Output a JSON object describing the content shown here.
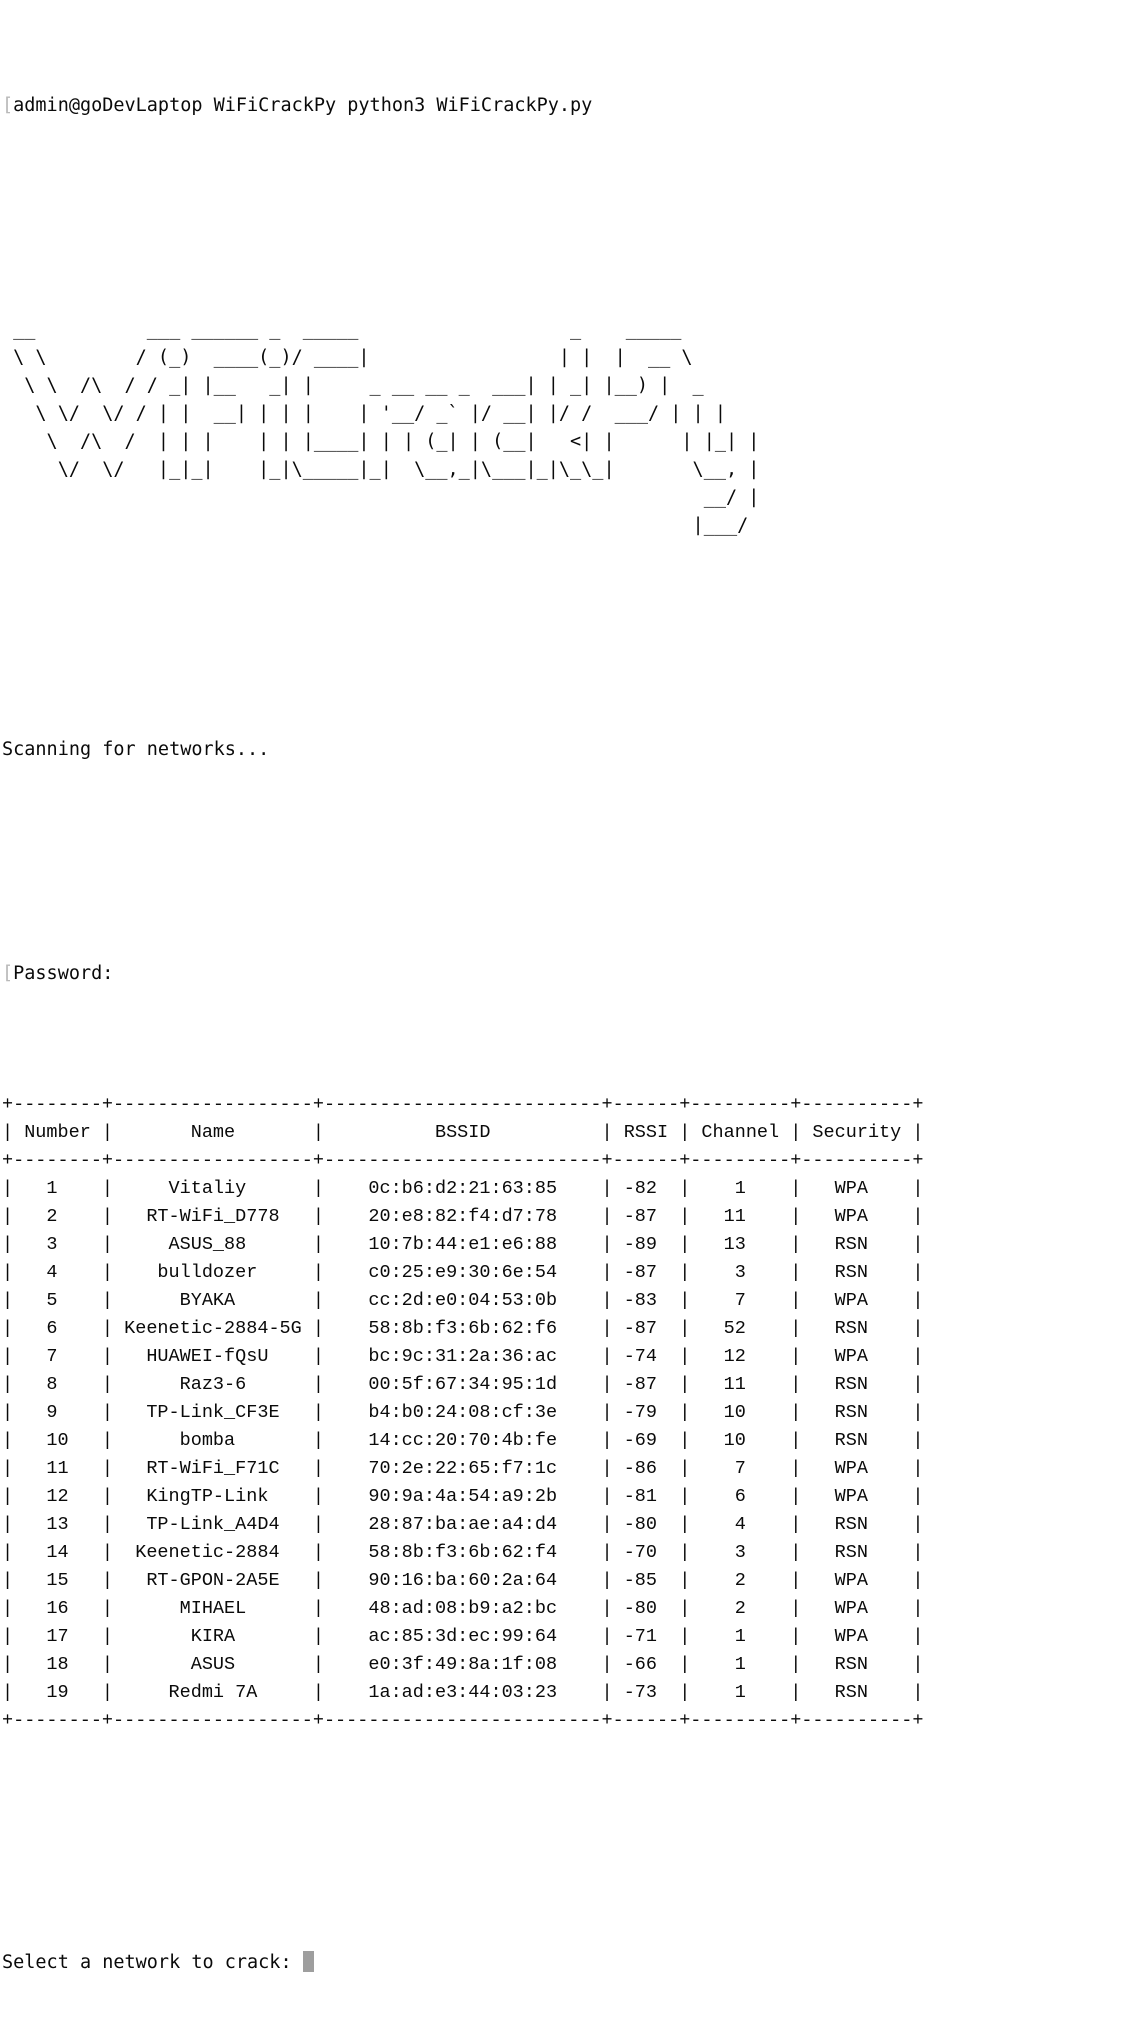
{
  "terminal": {
    "prompt_line": "[admin@goDevLaptop WiFiCrackPy python3 WiFiCrackPy.py",
    "banner": [
      " __          ___ ______ _  _____                   _    _____              ",
      " \\ \\        / (_)  ____(_)/ ____|                 | |  |  __ \\             ",
      "  \\ \\  /\\  / / _| |__   _| |     _ __ __ _  ___| | _| |__) |  _          ",
      "   \\ \\/  \\/ / | |  __| | | |    | '__/ _` |/ __| |/ /  ___/ | | |         ",
      "    \\  /\\  /  | | |    | | |____| | | (_| | (__|   <| |      | |_| |        ",
      "     \\/  \\/   |_|_|    |_|\\_____|_|  \\__,_|\\___|_|\\_\\_|       \\__, |       ",
      "                                                               __/ |       ",
      "                                                              |___/        "
    ],
    "scanning_message": "Scanning for networks...",
    "password_prompt": "Password:",
    "select_prompt": "Select a network to crack: ",
    "cursor_char": "block-cursor"
  },
  "table": {
    "columns": [
      {
        "label": "Number",
        "width": 8
      },
      {
        "label": "Name",
        "width": 18
      },
      {
        "label": "BSSID",
        "width": 25
      },
      {
        "label": "RSSI",
        "width": 6
      },
      {
        "label": "Channel",
        "width": 9
      },
      {
        "label": "Security",
        "width": 10
      }
    ],
    "rows": [
      {
        "number": "1",
        "name": "Vitaliy",
        "bssid": "0c:b6:d2:21:63:85",
        "rssi": "-82",
        "channel": "1",
        "security": "WPA"
      },
      {
        "number": "2",
        "name": "RT-WiFi_D778",
        "bssid": "20:e8:82:f4:d7:78",
        "rssi": "-87",
        "channel": "11",
        "security": "WPA"
      },
      {
        "number": "3",
        "name": "ASUS_88",
        "bssid": "10:7b:44:e1:e6:88",
        "rssi": "-89",
        "channel": "13",
        "security": "RSN"
      },
      {
        "number": "4",
        "name": "bulldozer",
        "bssid": "c0:25:e9:30:6e:54",
        "rssi": "-87",
        "channel": "3",
        "security": "RSN"
      },
      {
        "number": "5",
        "name": "BYAKA",
        "bssid": "cc:2d:e0:04:53:0b",
        "rssi": "-83",
        "channel": "7",
        "security": "WPA"
      },
      {
        "number": "6",
        "name": "Keenetic-2884-5G",
        "bssid": "58:8b:f3:6b:62:f6",
        "rssi": "-87",
        "channel": "52",
        "security": "RSN"
      },
      {
        "number": "7",
        "name": "HUAWEI-fQsU",
        "bssid": "bc:9c:31:2a:36:ac",
        "rssi": "-74",
        "channel": "12",
        "security": "WPA"
      },
      {
        "number": "8",
        "name": "Raz3-6",
        "bssid": "00:5f:67:34:95:1d",
        "rssi": "-87",
        "channel": "11",
        "security": "RSN"
      },
      {
        "number": "9",
        "name": "TP-Link_CF3E",
        "bssid": "b4:b0:24:08:cf:3e",
        "rssi": "-79",
        "channel": "10",
        "security": "RSN"
      },
      {
        "number": "10",
        "name": "bomba",
        "bssid": "14:cc:20:70:4b:fe",
        "rssi": "-69",
        "channel": "10",
        "security": "RSN"
      },
      {
        "number": "11",
        "name": "RT-WiFi_F71C",
        "bssid": "70:2e:22:65:f7:1c",
        "rssi": "-86",
        "channel": "7",
        "security": "WPA"
      },
      {
        "number": "12",
        "name": "KingTP-Link",
        "bssid": "90:9a:4a:54:a9:2b",
        "rssi": "-81",
        "channel": "6",
        "security": "WPA"
      },
      {
        "number": "13",
        "name": "TP-Link_A4D4",
        "bssid": "28:87:ba:ae:a4:d4",
        "rssi": "-80",
        "channel": "4",
        "security": "RSN"
      },
      {
        "number": "14",
        "name": "Keenetic-2884",
        "bssid": "58:8b:f3:6b:62:f4",
        "rssi": "-70",
        "channel": "3",
        "security": "RSN"
      },
      {
        "number": "15",
        "name": "RT-GPON-2A5E",
        "bssid": "90:16:ba:60:2a:64",
        "rssi": "-85",
        "channel": "2",
        "security": "WPA"
      },
      {
        "number": "16",
        "name": "MIHAEL",
        "bssid": "48:ad:08:b9:a2:bc",
        "rssi": "-80",
        "channel": "2",
        "security": "WPA"
      },
      {
        "number": "17",
        "name": "KIRA",
        "bssid": "ac:85:3d:ec:99:64",
        "rssi": "-71",
        "channel": "1",
        "security": "WPA"
      },
      {
        "number": "18",
        "name": "ASUS",
        "bssid": "e0:3f:49:8a:1f:08",
        "rssi": "-66",
        "channel": "1",
        "security": "RSN"
      },
      {
        "number": "19",
        "name": "Redmi 7A",
        "bssid": "1a:ad:e3:44:03:23",
        "rssi": "-73",
        "channel": "1",
        "security": "RSN"
      }
    ]
  },
  "colors": {
    "background": "#ffffff",
    "foreground": "#0a0a0a",
    "cursor": "#9e9e9e",
    "dim_bracket": "#b9b9b9"
  }
}
